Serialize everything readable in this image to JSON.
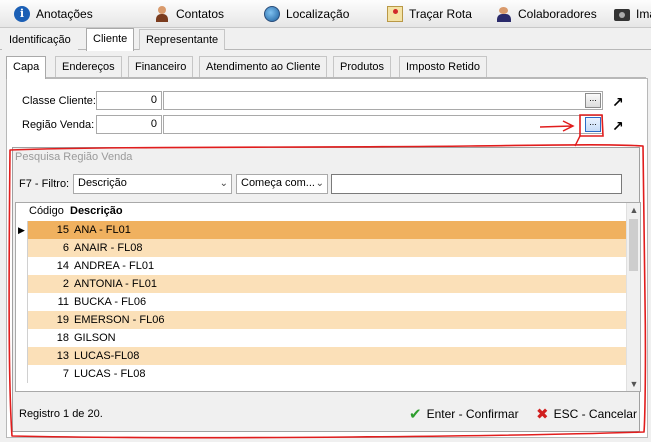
{
  "toolbar": {
    "items": [
      {
        "label": "Anotações",
        "icon": "info-icon"
      },
      {
        "label": "Contatos",
        "icon": "person-icon"
      },
      {
        "label": "Localização",
        "icon": "globe-icon"
      },
      {
        "label": "Traçar Rota",
        "icon": "map-icon"
      },
      {
        "label": "Colaboradores",
        "icon": "people-icon"
      },
      {
        "label": "Ima",
        "icon": "camera-icon"
      }
    ]
  },
  "tabs_main": [
    "Identificação",
    "Cliente",
    "Representante"
  ],
  "tabs_main_active": "Cliente",
  "tabs_sub": [
    "Capa",
    "Endereços",
    "Financeiro",
    "Atendimento ao Cliente",
    "Produtos",
    "Imposto Retido"
  ],
  "tabs_sub_active": "Capa",
  "form": {
    "classe_label": "Classe Cliente:",
    "classe_code": "0",
    "regiao_label": "Região Venda:",
    "regiao_code": "0",
    "ellipsis": "..."
  },
  "popup": {
    "title": "Pesquisa Região Venda",
    "filter_label": "F7 - Filtro:",
    "filter_field": "Descrição",
    "filter_mode": "Começa com...",
    "search_value": "",
    "columns": {
      "code": "Código",
      "desc": "Descrição"
    },
    "rows": [
      {
        "code": "15",
        "desc": "ANA - FL01"
      },
      {
        "code": "6",
        "desc": "ANAIR - FL08"
      },
      {
        "code": "14",
        "desc": "ANDREA - FL01"
      },
      {
        "code": "2",
        "desc": "ANTONIA - FL01"
      },
      {
        "code": "11",
        "desc": "BUCKA - FL06"
      },
      {
        "code": "19",
        "desc": "EMERSON - FL06"
      },
      {
        "code": "18",
        "desc": "GILSON"
      },
      {
        "code": "13",
        "desc": "LUCAS-FL08"
      },
      {
        "code": "7",
        "desc": "LUCAS - FL08"
      }
    ],
    "selected_index": 0,
    "status": "Registro 1 de 20.",
    "confirm_label": "Enter - Confirmar",
    "cancel_label": "ESC - Cancelar"
  },
  "colors": {
    "row_selected": "#f0b15f",
    "row_alt": "#fbe0b8",
    "row_plain": "#ffffff",
    "annotation": "#e11d1d"
  }
}
